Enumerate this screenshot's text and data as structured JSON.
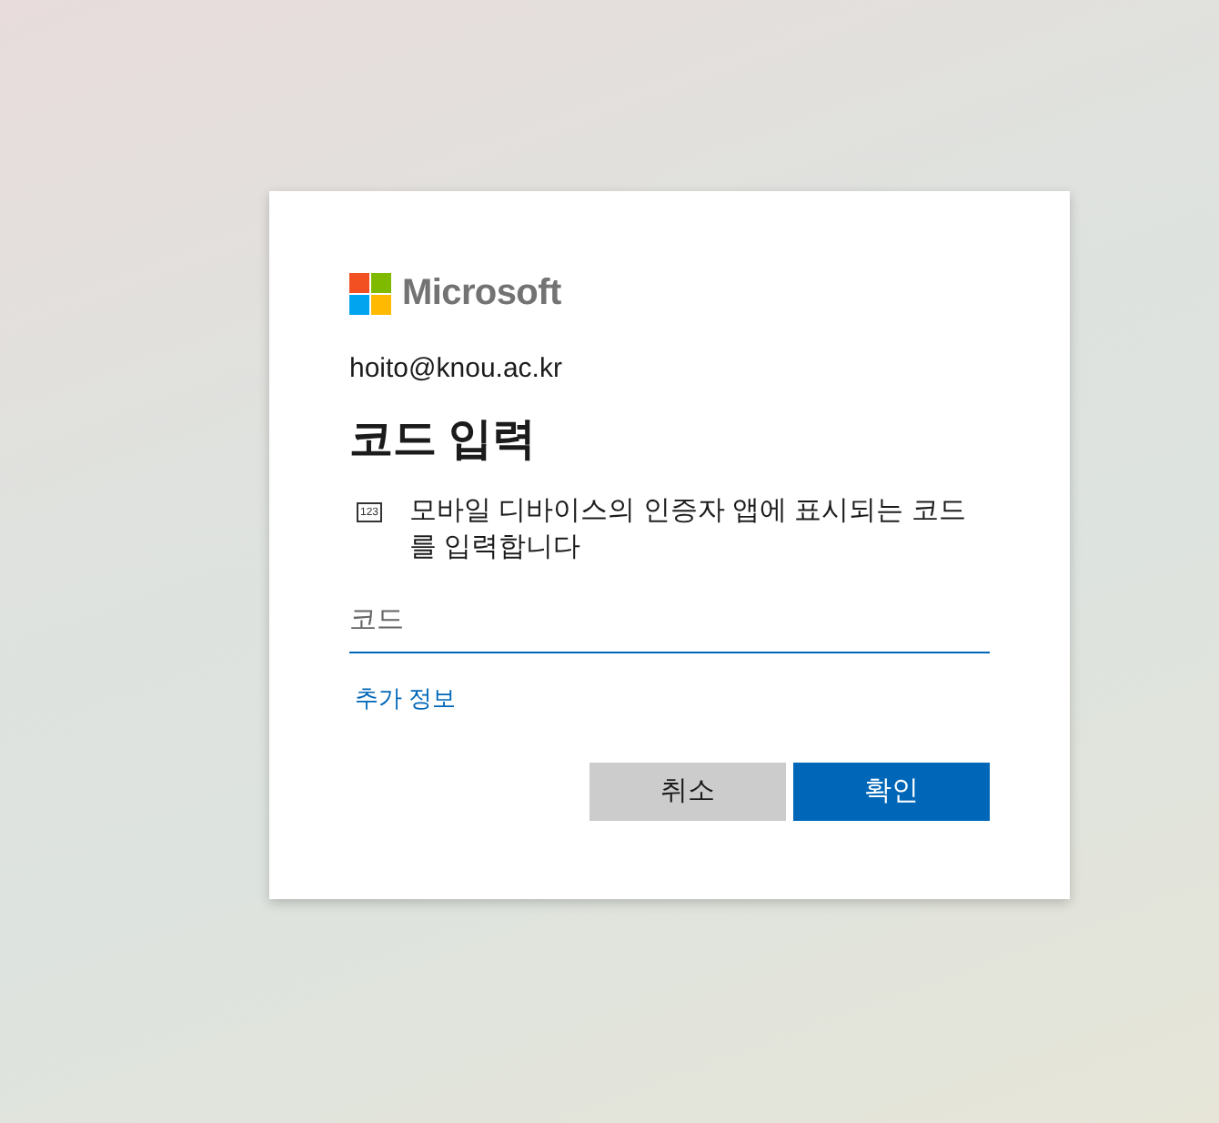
{
  "logo": {
    "text": "Microsoft"
  },
  "account": "hoito@knou.ac.kr",
  "title": "코드 입력",
  "description": {
    "icon_text": "123",
    "text": "모바일 디바이스의 인증자 앱에 표시되는 코드를 입력합니다"
  },
  "code_field": {
    "placeholder": "코드",
    "focused": true
  },
  "link": "추가 정보",
  "buttons": [
    {
      "label": "취소",
      "kind": "secondary"
    },
    {
      "label": "확인",
      "kind": "primary"
    }
  ]
}
